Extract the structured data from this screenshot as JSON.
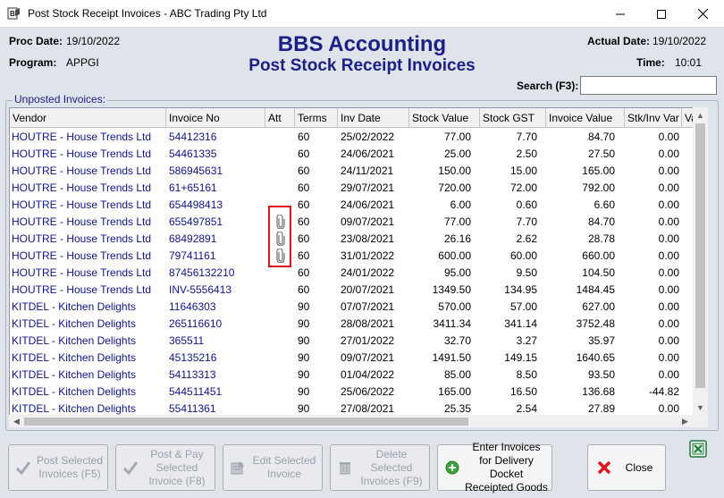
{
  "window": {
    "title": "Post Stock Receipt Invoices - ABC Trading Pty Ltd",
    "app_icon": "bbs-app-icon",
    "minimize_icon": "minimize-icon",
    "maximize_icon": "maximize-icon",
    "close_icon": "close-icon"
  },
  "header": {
    "proc_date_label": "Proc Date:",
    "proc_date": "19/10/2022",
    "program_label": "Program:",
    "program": "APPGI",
    "title": "BBS Accounting",
    "subtitle": "Post Stock Receipt Invoices",
    "actual_date_label": "Actual Date:",
    "actual_date": "19/10/2022",
    "time_label": "Time:",
    "time": "10:01"
  },
  "search": {
    "label": "Search (F3):",
    "value": "",
    "placeholder": ""
  },
  "group": {
    "label": "Unposted Invoices:"
  },
  "grid": {
    "columns": [
      "Vendor",
      "Invoice No",
      "Att",
      "Terms",
      "Inv Date",
      "Stock Value",
      "Stock GST",
      "Invoice Value",
      "Stk/Inv Var",
      "Va"
    ],
    "rows": [
      {
        "vendor": "HOUTRE - House Trends Ltd",
        "invoice_no": "54412316",
        "att": false,
        "terms": "60",
        "inv_date": "25/02/2022",
        "stock_value": "77.00",
        "stock_gst": "7.70",
        "invoice_value": "84.70",
        "var": "0.00"
      },
      {
        "vendor": "HOUTRE - House Trends Ltd",
        "invoice_no": "54461335",
        "att": false,
        "terms": "60",
        "inv_date": "24/06/2021",
        "stock_value": "25.00",
        "stock_gst": "2.50",
        "invoice_value": "27.50",
        "var": "0.00"
      },
      {
        "vendor": "HOUTRE - House Trends Ltd",
        "invoice_no": "586945631",
        "att": false,
        "terms": "60",
        "inv_date": "24/11/2021",
        "stock_value": "150.00",
        "stock_gst": "15.00",
        "invoice_value": "165.00",
        "var": "0.00"
      },
      {
        "vendor": "HOUTRE - House Trends Ltd",
        "invoice_no": "61+65161",
        "att": false,
        "terms": "60",
        "inv_date": "29/07/2021",
        "stock_value": "720.00",
        "stock_gst": "72.00",
        "invoice_value": "792.00",
        "var": "0.00"
      },
      {
        "vendor": "HOUTRE - House Trends Ltd",
        "invoice_no": "654498413",
        "att": false,
        "terms": "60",
        "inv_date": "24/06/2021",
        "stock_value": "6.00",
        "stock_gst": "0.60",
        "invoice_value": "6.60",
        "var": "0.00"
      },
      {
        "vendor": "HOUTRE - House Trends Ltd",
        "invoice_no": "655497851",
        "att": true,
        "terms": "60",
        "inv_date": "09/07/2021",
        "stock_value": "77.00",
        "stock_gst": "7.70",
        "invoice_value": "84.70",
        "var": "0.00"
      },
      {
        "vendor": "HOUTRE - House Trends Ltd",
        "invoice_no": "68492891",
        "att": true,
        "terms": "60",
        "inv_date": "23/08/2021",
        "stock_value": "26.16",
        "stock_gst": "2.62",
        "invoice_value": "28.78",
        "var": "0.00"
      },
      {
        "vendor": "HOUTRE - House Trends Ltd",
        "invoice_no": "79741161",
        "att": true,
        "terms": "60",
        "inv_date": "31/01/2022",
        "stock_value": "600.00",
        "stock_gst": "60.00",
        "invoice_value": "660.00",
        "var": "0.00"
      },
      {
        "vendor": "HOUTRE - House Trends Ltd",
        "invoice_no": "87456132210",
        "att": false,
        "terms": "60",
        "inv_date": "24/01/2022",
        "stock_value": "95.00",
        "stock_gst": "9.50",
        "invoice_value": "104.50",
        "var": "0.00"
      },
      {
        "vendor": "HOUTRE - House Trends Ltd",
        "invoice_no": "INV-5556413",
        "att": false,
        "terms": "60",
        "inv_date": "20/07/2021",
        "stock_value": "1349.50",
        "stock_gst": "134.95",
        "invoice_value": "1484.45",
        "var": "0.00"
      },
      {
        "vendor": "KITDEL - Kitchen Delights",
        "invoice_no": "11646303",
        "att": false,
        "terms": "90",
        "inv_date": "07/07/2021",
        "stock_value": "570.00",
        "stock_gst": "57.00",
        "invoice_value": "627.00",
        "var": "0.00"
      },
      {
        "vendor": "KITDEL - Kitchen Delights",
        "invoice_no": "265116610",
        "att": false,
        "terms": "90",
        "inv_date": "28/08/2021",
        "stock_value": "3411.34",
        "stock_gst": "341.14",
        "invoice_value": "3752.48",
        "var": "0.00"
      },
      {
        "vendor": "KITDEL - Kitchen Delights",
        "invoice_no": "365511",
        "att": false,
        "terms": "90",
        "inv_date": "27/01/2022",
        "stock_value": "32.70",
        "stock_gst": "3.27",
        "invoice_value": "35.97",
        "var": "0.00"
      },
      {
        "vendor": "KITDEL - Kitchen Delights",
        "invoice_no": "45135216",
        "att": false,
        "terms": "90",
        "inv_date": "09/07/2021",
        "stock_value": "1491.50",
        "stock_gst": "149.15",
        "invoice_value": "1640.65",
        "var": "0.00"
      },
      {
        "vendor": "KITDEL - Kitchen Delights",
        "invoice_no": "54113313",
        "att": false,
        "terms": "90",
        "inv_date": "01/04/2022",
        "stock_value": "85.00",
        "stock_gst": "8.50",
        "invoice_value": "93.50",
        "var": "0.00"
      },
      {
        "vendor": "KITDEL - Kitchen Delights",
        "invoice_no": "544511451",
        "att": false,
        "terms": "90",
        "inv_date": "25/06/2022",
        "stock_value": "165.00",
        "stock_gst": "16.50",
        "invoice_value": "136.68",
        "var": "-44.82"
      },
      {
        "vendor": "KITDEL - Kitchen Delights",
        "invoice_no": "55411361",
        "att": false,
        "terms": "90",
        "inv_date": "27/08/2021",
        "stock_value": "25.35",
        "stock_gst": "2.54",
        "invoice_value": "27.89",
        "var": "0.00"
      }
    ]
  },
  "buttons": {
    "post_selected": "Post Selected Invoices (F5)",
    "post_pay": "Post & Pay Selected Invoice (F8)",
    "edit_selected": "Edit Selected Invoice",
    "delete_selected": "Delete Selected Invoices (F9)",
    "enter_invoices": "Enter Invoices for Delivery Docket Receipted Goods",
    "close": "Close"
  },
  "colors": {
    "title_blue": "#1c1f86",
    "link_blue": "#10148a",
    "highlight_red": "#e0141b",
    "close_red": "#e0141b",
    "add_green": "#3aa63a"
  }
}
